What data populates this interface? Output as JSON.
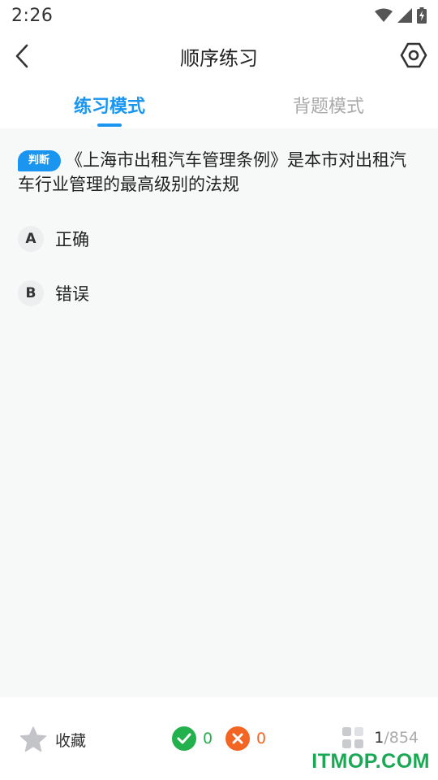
{
  "status_bar": {
    "time": "2:26",
    "icons": [
      "wifi-icon",
      "signal-icon",
      "battery-charging-icon"
    ]
  },
  "header": {
    "title": "顺序练习",
    "back_icon": "chevron-left-icon",
    "settings_icon": "hexagon-settings-icon"
  },
  "tabs": [
    {
      "label": "练习模式",
      "active": true
    },
    {
      "label": "背题模式",
      "active": false
    }
  ],
  "question": {
    "type_badge": "判断",
    "text": "《上海市出租汽车管理条例》是本市对出租汽车行业管理的最高级别的法规",
    "options": [
      {
        "key": "A",
        "text": "正确"
      },
      {
        "key": "B",
        "text": "错误"
      }
    ]
  },
  "bottom_bar": {
    "favorite_label": "收藏",
    "correct_count": "0",
    "wrong_count": "0",
    "current_index": "1",
    "total": "/854"
  },
  "watermark": "ITMOP.COM",
  "colors": {
    "accent": "#1a96f0",
    "correct": "#22b14c",
    "wrong": "#f26522"
  }
}
